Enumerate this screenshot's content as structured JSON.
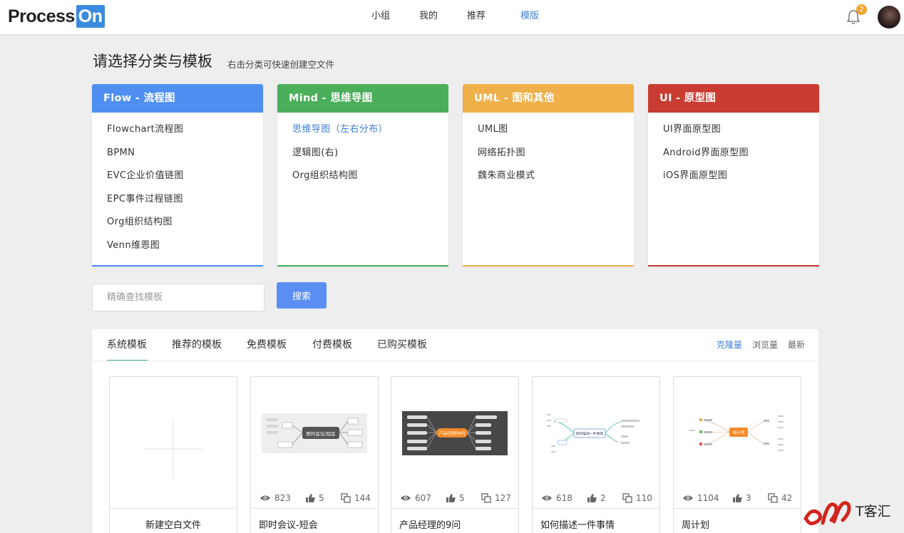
{
  "header": {
    "logo_part1": "Process",
    "logo_part2": "On",
    "nav": [
      {
        "label": "小组"
      },
      {
        "label": "我的"
      },
      {
        "label": "推荐"
      },
      {
        "label": "模版"
      }
    ],
    "notification_count": "2"
  },
  "page": {
    "title": "请选择分类与模板",
    "subtitle": "右击分类可快速创建空文件"
  },
  "categories": [
    {
      "title": "Flow - 流程图",
      "color": "#4f8ff2",
      "items": [
        "Flowchart流程图",
        "BPMN",
        "EVC企业价值链图",
        "EPC事件过程链图",
        "Org组织结构图",
        "Venn维恩图"
      ]
    },
    {
      "title": "Mind - 思维导图",
      "color": "#4aae5a",
      "items": [
        "思维导图（左右分布）",
        "逻辑图(右)",
        "Org组织结构图"
      ]
    },
    {
      "title": "UML - 图和其他",
      "color": "#efb04a",
      "items": [
        "UML图",
        "网络拓扑图",
        "魏朱商业模式"
      ]
    },
    {
      "title": "UI - 原型图",
      "color": "#c93c32",
      "items": [
        "UI界面原型图",
        "Android界面原型图",
        "iOS界面原型图"
      ]
    }
  ],
  "search": {
    "placeholder": "精确查找模板",
    "button": "搜索"
  },
  "tabs": [
    "系统模板",
    "推荐的模板",
    "免费模板",
    "付费模板",
    "已购买模板"
  ],
  "sort": [
    "克隆量",
    "浏览量",
    "最新"
  ],
  "templates": [
    {
      "title": "新建空白文件"
    },
    {
      "title": "即时会议-短会",
      "views": "823",
      "likes": "5",
      "clones": "144",
      "thumb_text": "即时会议/短会"
    },
    {
      "title": "产品经理的9问",
      "views": "607",
      "likes": "5",
      "clones": "127",
      "thumb_text": "产品经理的9问"
    },
    {
      "title": "如何描述一件事情",
      "views": "618",
      "likes": "2",
      "clones": "110",
      "thumb_text": "如何描述一件事情"
    },
    {
      "title": "周计划",
      "views": "1104",
      "likes": "3",
      "clones": "42",
      "thumb_text": "周计划"
    }
  ],
  "watermark": {
    "text": "T客汇"
  },
  "colors": {
    "accent": "#3f7fd6",
    "tab_underline": "#48b06f",
    "search_button": "#5b8ef2"
  }
}
